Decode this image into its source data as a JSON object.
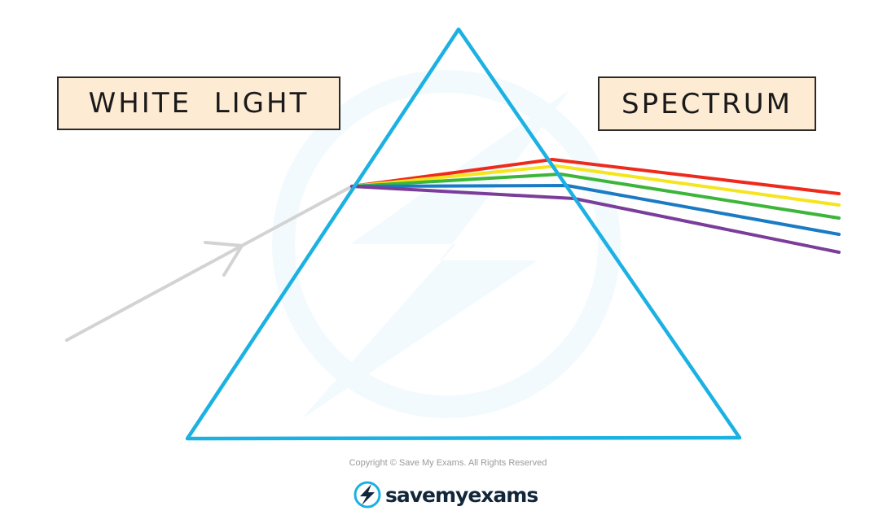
{
  "labels": {
    "incident": "WHITE  LIGHT",
    "output": "SPECTRUM"
  },
  "footer": {
    "copyright": "Copyright © Save My Exams. All Rights Reserved",
    "brand": "savemyexams"
  },
  "colors": {
    "prism": "#1bb1e3",
    "label_fill": "#fdebd3",
    "incident_ray": "#d3d3d3",
    "spectrum": [
      "#ee2a1c",
      "#f5e51f",
      "#3db53a",
      "#1a7bc4",
      "#7a3d9a"
    ]
  },
  "icons": {
    "brand": "lightning-bolt-circle-icon",
    "arrow": "arrowhead-icon"
  }
}
